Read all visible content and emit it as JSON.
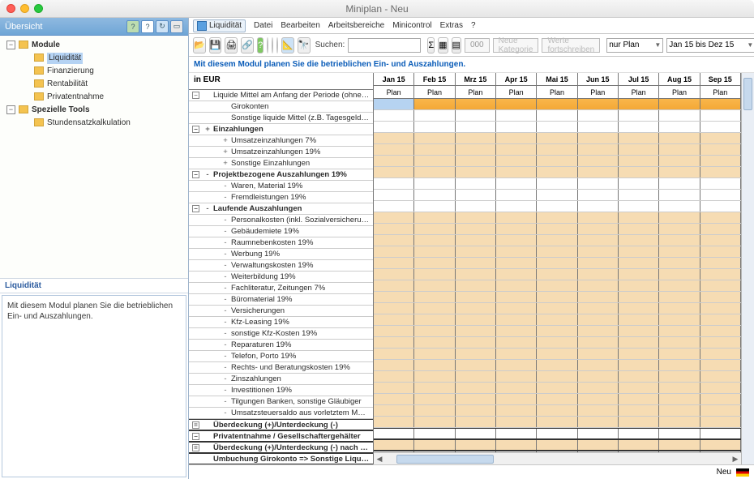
{
  "window": {
    "title": "Miniplan - Neu"
  },
  "sidebar": {
    "title": "Übersicht",
    "module_label": "Module",
    "items": [
      "Liquidität",
      "Finanzierung",
      "Rentabilität",
      "Privatentnahme"
    ],
    "tools_label": "Spezielle Tools",
    "tool_items": [
      "Stundensatzkalkulation"
    ],
    "info_title": "Liquidität",
    "info_text": "Mit diesem Modul planen Sie die betrieblichen Ein- und Auszahlungen."
  },
  "menu": {
    "tab": "Liquidität",
    "items": [
      "Datei",
      "Bearbeiten",
      "Arbeitsbereiche",
      "Minicontrol",
      "Extras",
      "?"
    ]
  },
  "toolbar": {
    "search_label": "Suchen:",
    "sum": "Σ",
    "zeros": "000",
    "new_category": "Neue Kategorie",
    "forward": "Werte fortschreiben",
    "plan_dd": "nur Plan",
    "range_dd": "Jan 15 bis Dez 15"
  },
  "instruction": "Mit diesem Modul planen Sie die betrieblichen Ein- und Auszahlungen.",
  "grid": {
    "left_header": "in EUR",
    "months": [
      "Jan 15",
      "Feb 15",
      "Mrz 15",
      "Apr 15",
      "Mai 15",
      "Jun 15",
      "Jul 15",
      "Aug 15",
      "Sep 15"
    ],
    "subhead": "Plan",
    "rows": [
      {
        "lvl": 0,
        "exp": "-",
        "plus": "",
        "label": "Liquide Mittel am Anfang der Periode (ohne Kontok...",
        "style": "orangebar"
      },
      {
        "lvl": 2,
        "exp": "",
        "plus": "",
        "label": "Girokonten",
        "style": "white"
      },
      {
        "lvl": 2,
        "exp": "",
        "plus": "",
        "label": "Sonstige liquide Mittel (z.B. Tagesgeldkonto)",
        "style": "white"
      },
      {
        "lvl": 0,
        "exp": "-",
        "plus": "+",
        "label": "Einzahlungen",
        "style": "peach",
        "bold": true
      },
      {
        "lvl": 2,
        "exp": "",
        "plus": "+",
        "label": "Umsatzeinzahlungen 7%",
        "style": "peach"
      },
      {
        "lvl": 2,
        "exp": "",
        "plus": "+",
        "label": "Umsatzeinzahlungen 19%",
        "style": "peach"
      },
      {
        "lvl": 2,
        "exp": "",
        "plus": "+",
        "label": "Sonstige Einzahlungen",
        "style": "peach"
      },
      {
        "lvl": 0,
        "exp": "-",
        "plus": "-",
        "label": "Projektbezogene Auszahlungen 19%",
        "style": "white",
        "bold": true
      },
      {
        "lvl": 2,
        "exp": "",
        "plus": "-",
        "label": "Waren, Material 19%",
        "style": "white"
      },
      {
        "lvl": 2,
        "exp": "",
        "plus": "-",
        "label": "Fremdleistungen 19%",
        "style": "white"
      },
      {
        "lvl": 0,
        "exp": "-",
        "plus": "-",
        "label": "Laufende Auszahlungen",
        "style": "peach",
        "bold": true
      },
      {
        "lvl": 2,
        "exp": "",
        "plus": "-",
        "label": "Personalkosten (inkl. Sozialversicherung und Lo...",
        "style": "peach"
      },
      {
        "lvl": 2,
        "exp": "",
        "plus": "-",
        "label": "Gebäudemiete 19%",
        "style": "peach"
      },
      {
        "lvl": 2,
        "exp": "",
        "plus": "-",
        "label": "Raumnebenkosten 19%",
        "style": "peach"
      },
      {
        "lvl": 2,
        "exp": "",
        "plus": "-",
        "label": "Werbung 19%",
        "style": "peach"
      },
      {
        "lvl": 2,
        "exp": "",
        "plus": "-",
        "label": "Verwaltungskosten 19%",
        "style": "peach"
      },
      {
        "lvl": 2,
        "exp": "",
        "plus": "-",
        "label": "Weiterbildung 19%",
        "style": "peach"
      },
      {
        "lvl": 2,
        "exp": "",
        "plus": "-",
        "label": "Fachliteratur, Zeitungen 7%",
        "style": "peach"
      },
      {
        "lvl": 2,
        "exp": "",
        "plus": "-",
        "label": "Büromaterial 19%",
        "style": "peach"
      },
      {
        "lvl": 2,
        "exp": "",
        "plus": "-",
        "label": "Versicherungen",
        "style": "peach"
      },
      {
        "lvl": 2,
        "exp": "",
        "plus": "-",
        "label": "Kfz-Leasing 19%",
        "style": "peach"
      },
      {
        "lvl": 2,
        "exp": "",
        "plus": "-",
        "label": "sonstige Kfz-Kosten 19%",
        "style": "peach"
      },
      {
        "lvl": 2,
        "exp": "",
        "plus": "-",
        "label": "Reparaturen 19%",
        "style": "peach"
      },
      {
        "lvl": 2,
        "exp": "",
        "plus": "-",
        "label": "Telefon, Porto 19%",
        "style": "peach"
      },
      {
        "lvl": 2,
        "exp": "",
        "plus": "-",
        "label": "Rechts- und Beratungskosten 19%",
        "style": "peach"
      },
      {
        "lvl": 2,
        "exp": "",
        "plus": "-",
        "label": "Zinszahlungen",
        "style": "peach"
      },
      {
        "lvl": 2,
        "exp": "",
        "plus": "-",
        "label": "Investitionen 19%",
        "style": "peach"
      },
      {
        "lvl": 2,
        "exp": "",
        "plus": "-",
        "label": "Tilgungen Banken, sonstige Gläubiger",
        "style": "peach"
      },
      {
        "lvl": 2,
        "exp": "",
        "plus": "-",
        "label": "Umsatzsteuersaldo aus vorletztem Monat an Fin...",
        "style": "peach"
      },
      {
        "lvl": 0,
        "exp": "=",
        "plus": "",
        "label": "Überdeckung (+)/Unterdeckung (-)",
        "style": "white",
        "sep": true
      },
      {
        "lvl": 0,
        "exp": "-",
        "plus": "",
        "label": "Privatentnahme / Gesellschaftergehälter",
        "style": "peach",
        "sep": true
      },
      {
        "lvl": 0,
        "exp": "=",
        "plus": "",
        "label": "Überdeckung (+)/Unterdeckung (-) nach Pri...",
        "style": "white",
        "sep": true
      },
      {
        "lvl": 0,
        "exp": "",
        "plus": "",
        "label": "Umbuchung Girokonto => Sonstige Liquide ...",
        "style": "peach",
        "sep": true
      }
    ]
  },
  "status": {
    "label": "Neu"
  }
}
